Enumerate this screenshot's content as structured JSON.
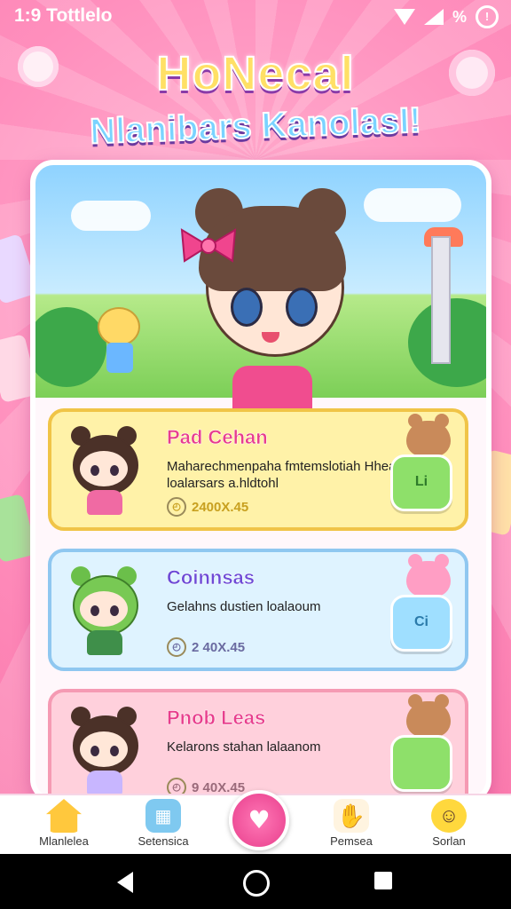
{
  "status_bar": {
    "time": "1:9 Tottlelo",
    "battery_text": "%"
  },
  "header": {
    "title_line1": "HoNecal",
    "title_line2": "Nlanibars KanolasI!"
  },
  "cards": [
    {
      "title": "Pad Cehan",
      "description": "Maharechmenpaha fmtemslotiah Hhea loalarsars a.hldtohl",
      "meta": "2400X.45",
      "action_label": "Li",
      "theme": "yellow"
    },
    {
      "title": "Coinnsas",
      "description": "Gelahns dustien loalaoum",
      "meta": "2 40X.45",
      "action_label": "Ci",
      "theme": "blue"
    },
    {
      "title": "Pnob Leas",
      "description": "Kelarons stahan lalaanom",
      "meta": "9 40X.45",
      "action_label": "",
      "theme": "pink"
    }
  ],
  "bottom_nav": {
    "items": [
      {
        "label": "Mlanlelea"
      },
      {
        "label": "Setensica"
      },
      {
        "label": ""
      },
      {
        "label": "Pemsea"
      },
      {
        "label": "Sorlan"
      }
    ]
  },
  "colors": {
    "accent": "#e83e8c",
    "background": "#ff8fbd"
  }
}
